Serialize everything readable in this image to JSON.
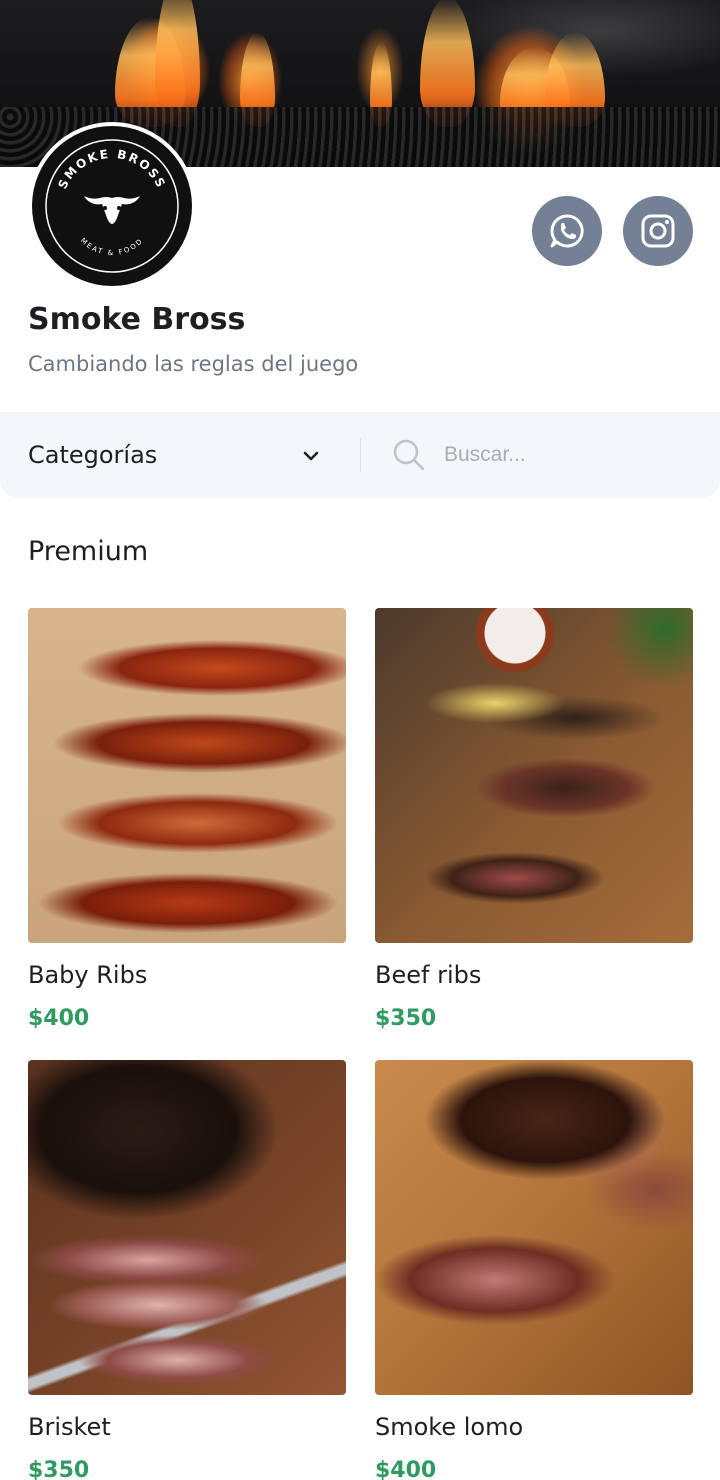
{
  "store": {
    "name": "Smoke Bross",
    "tagline": "Cambiando las reglas del juego",
    "logo_text_top": "SMOKE BROSS",
    "logo_text_bottom": "MEAT & FOOD"
  },
  "social": [
    {
      "icon": "whatsapp-icon"
    },
    {
      "icon": "instagram-icon"
    }
  ],
  "filters": {
    "category_label": "Categorías",
    "search_placeholder": "Buscar..."
  },
  "section": {
    "title": "Premium"
  },
  "products": [
    {
      "name": "Baby Ribs",
      "price": "$400"
    },
    {
      "name": "Beef ribs",
      "price": "$350"
    },
    {
      "name": "Brisket",
      "price": "$350"
    },
    {
      "name": "Smoke lomo",
      "price": "$400"
    }
  ],
  "colors": {
    "price": "#2e9b60",
    "social_button": "#748194",
    "filter_bar": "#f4f6fa"
  }
}
